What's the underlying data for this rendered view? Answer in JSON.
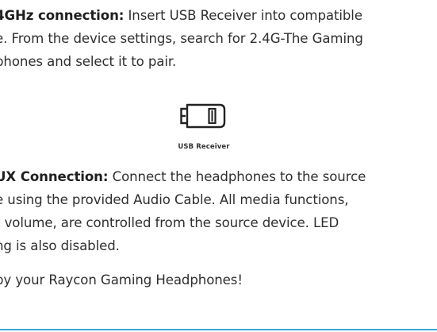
{
  "section_24ghz": {
    "heading": "4GHz connection:",
    "line1_rest": " Insert USB Receiver into compatible",
    "line2": "e. From the device settings, search for 2.4G-The Gaming",
    "line3": "phones and select it to pair."
  },
  "usb_figure": {
    "caption": "USB Receiver",
    "icon": "usb-receiver-icon"
  },
  "section_aux": {
    "heading": "UX Connection:",
    "line1_rest": " Connect the headphones to the source",
    "line2": "e using the provided Audio Cable. All media functions,",
    "line3": "t volume, are controlled from the source device. LED",
    "line4": "ng is also disabled."
  },
  "closing": {
    "text": "by your Raycon Gaming Headphones!"
  },
  "colors": {
    "divider": "#3aa7d4"
  }
}
